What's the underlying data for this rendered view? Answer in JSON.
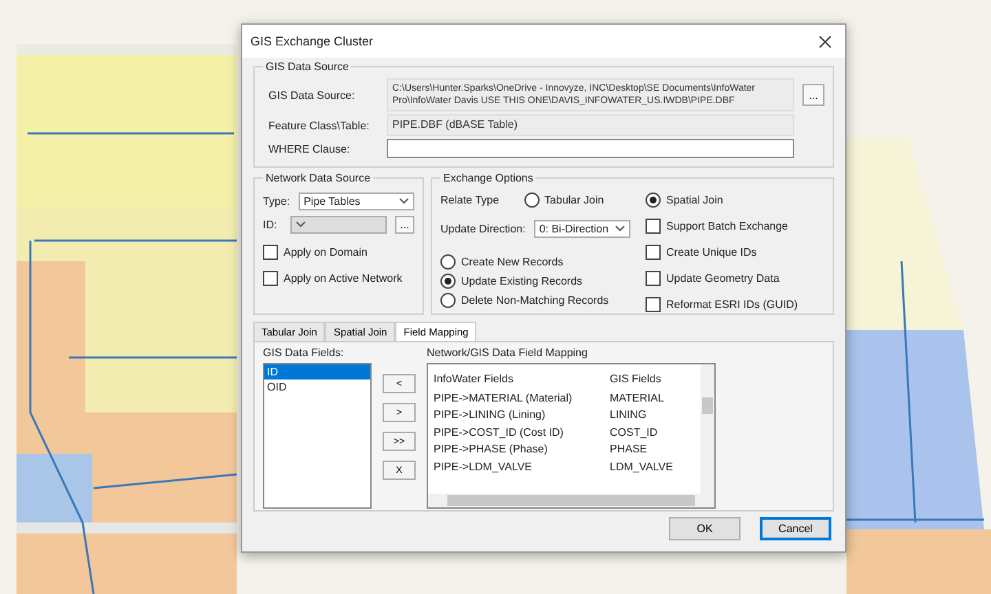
{
  "window": {
    "title": "GIS Exchange Cluster"
  },
  "gis_data_source": {
    "title": "GIS Data Source",
    "fields": [
      {
        "kind": "browse",
        "label": "GIS Data Source:",
        "value": "C:\\Users\\Hunter.Sparks\\OneDrive - Innovyze, INC\\Desktop\\SE Documents\\InfoWater Pro\\InfoWater Davis USE THIS ONE\\DAVIS_INFOWATER_US.IWDB\\PIPE.DBF",
        "button": "..."
      },
      {
        "kind": "readonly",
        "label": "Feature Class\\Table:",
        "value": "PIPE.DBF (dBASE Table)"
      },
      {
        "kind": "input",
        "label": "WHERE Clause:"
      }
    ]
  },
  "network_data_source": {
    "title": "Network Data Source",
    "type": {
      "label": "Type:",
      "value": "Pipe Tables"
    },
    "id": {
      "label": "ID:",
      "disabled": true,
      "button": "..."
    },
    "checkboxes": [
      {
        "label": "Apply on Domain",
        "checked": false
      },
      {
        "label": "Apply on Active Network",
        "checked": false
      }
    ]
  },
  "exchange_options": {
    "title": "Exchange Options",
    "relate_type": {
      "label": "Relate Type",
      "options": [
        {
          "label": "Tabular Join",
          "selected": false
        },
        {
          "label": "Spatial Join",
          "selected": true
        }
      ]
    },
    "update_direction": {
      "label": "Update Direction:",
      "value": "0: Bi-Direction"
    },
    "records": [
      {
        "label": "Create New Records",
        "selected": false
      },
      {
        "label": "Update Existing Records",
        "selected": true
      },
      {
        "label": "Delete Non-Matching Records",
        "selected": false
      }
    ],
    "checkboxes": [
      {
        "label": "Support Batch Exchange",
        "checked": false
      },
      {
        "label": "Create Unique IDs",
        "checked": false
      },
      {
        "label": "Update Geometry Data",
        "checked": false
      },
      {
        "label": "Reformat ESRI IDs (GUID)",
        "checked": false
      }
    ]
  },
  "tabs": [
    {
      "label": "Tabular Join",
      "selected": false
    },
    {
      "label": "Spatial Join",
      "selected": false
    },
    {
      "label": "Field Mapping",
      "selected": true
    }
  ],
  "gis_data_fields": {
    "label": "GIS Data Fields:",
    "items": [
      {
        "label": "ID",
        "selected": true
      },
      {
        "label": "OID",
        "selected": false
      }
    ]
  },
  "move_buttons": [
    "<",
    ">",
    ">>",
    "X"
  ],
  "mapping": {
    "title": "Network/GIS Data Field Mapping",
    "columns": [
      "InfoWater Fields",
      "GIS Fields"
    ],
    "rows": [
      [
        "PIPE->MATERIAL (Material)",
        "MATERIAL"
      ],
      [
        "PIPE->LINING (Lining)",
        "LINING"
      ],
      [
        "PIPE->COST_ID (Cost ID)",
        "COST_ID"
      ],
      [
        "PIPE->PHASE (Phase)",
        "PHASE"
      ],
      [
        "PIPE->LDM_VALVE",
        "LDM_VALVE"
      ]
    ]
  },
  "buttons": [
    {
      "label": "OK",
      "focused": false
    },
    {
      "label": "Cancel",
      "focused": true
    }
  ]
}
